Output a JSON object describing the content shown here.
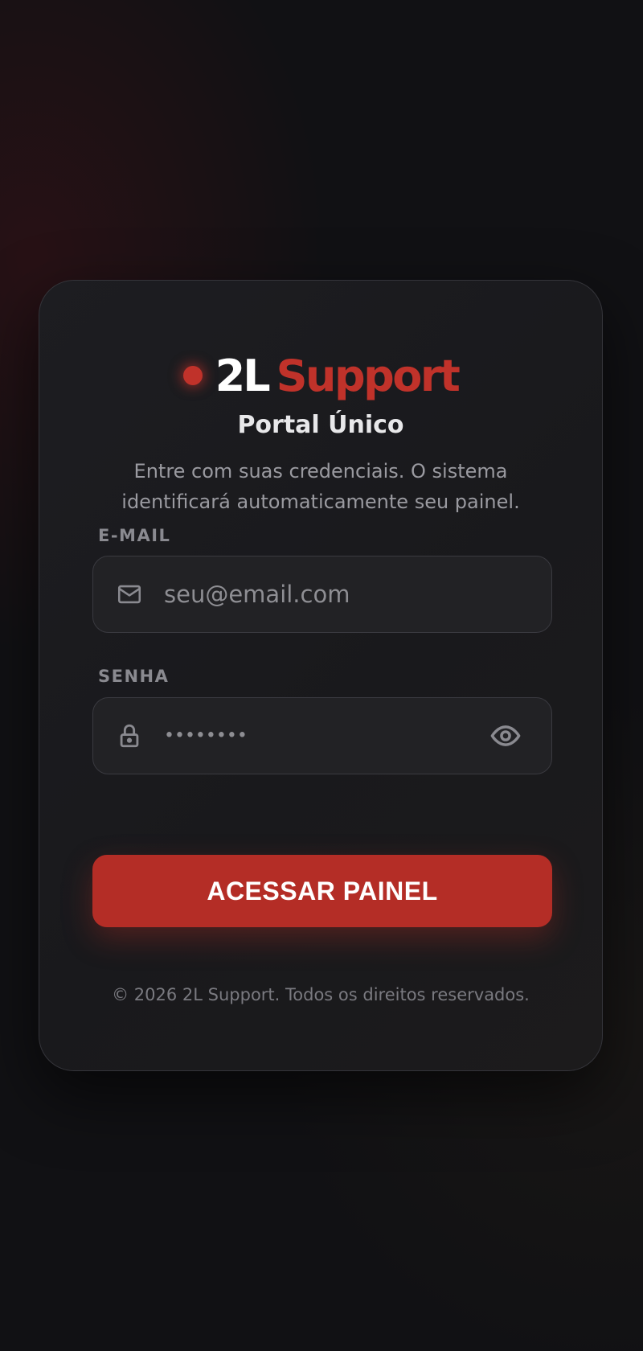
{
  "brand": {
    "part1": "2L",
    "part2": "Support",
    "dot_color": "#c0322a",
    "accent_color": "#c0322a"
  },
  "header": {
    "title": "Portal Único",
    "subtitle": "Entre com suas credenciais. O sistema identificará automaticamente seu painel."
  },
  "form": {
    "email": {
      "label": "E-MAIL",
      "placeholder": "seu@email.com",
      "value": "",
      "icon": "mail-icon"
    },
    "password": {
      "label": "SENHA",
      "masked_value": "••••••••",
      "icon": "lock-icon",
      "toggle_icon": "eye-icon"
    },
    "submit_label": "ACESSAR PAINEL",
    "submit_color": "#b42d26"
  },
  "footer": {
    "text": "© 2026 2L Support. Todos os direitos reservados."
  }
}
